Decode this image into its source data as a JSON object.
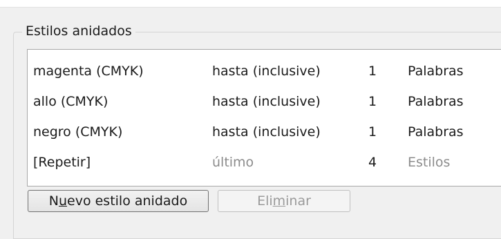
{
  "groupbox": {
    "title": "Estilos anidados"
  },
  "nested_styles": {
    "rows": [
      {
        "style": "magenta (CMYK)",
        "mode": "hasta (inclusive)",
        "count": "1",
        "unit": "Palabras",
        "disabled": false
      },
      {
        "style": "allo (CMYK)",
        "mode": "hasta (inclusive)",
        "count": "1",
        "unit": "Palabras",
        "disabled": false
      },
      {
        "style": "negro (CMYK)",
        "mode": "hasta (inclusive)",
        "count": "1",
        "unit": "Palabras",
        "disabled": false
      },
      {
        "style": "[Repetir]",
        "mode": "último",
        "count": "4",
        "unit": "Estilos",
        "disabled": true
      }
    ]
  },
  "buttons": {
    "new_pre": "N",
    "new_mnemonic": "u",
    "new_post": "evo estilo anidado",
    "delete_pre": "Eli",
    "delete_mnemonic": "m",
    "delete_post": "inar"
  }
}
